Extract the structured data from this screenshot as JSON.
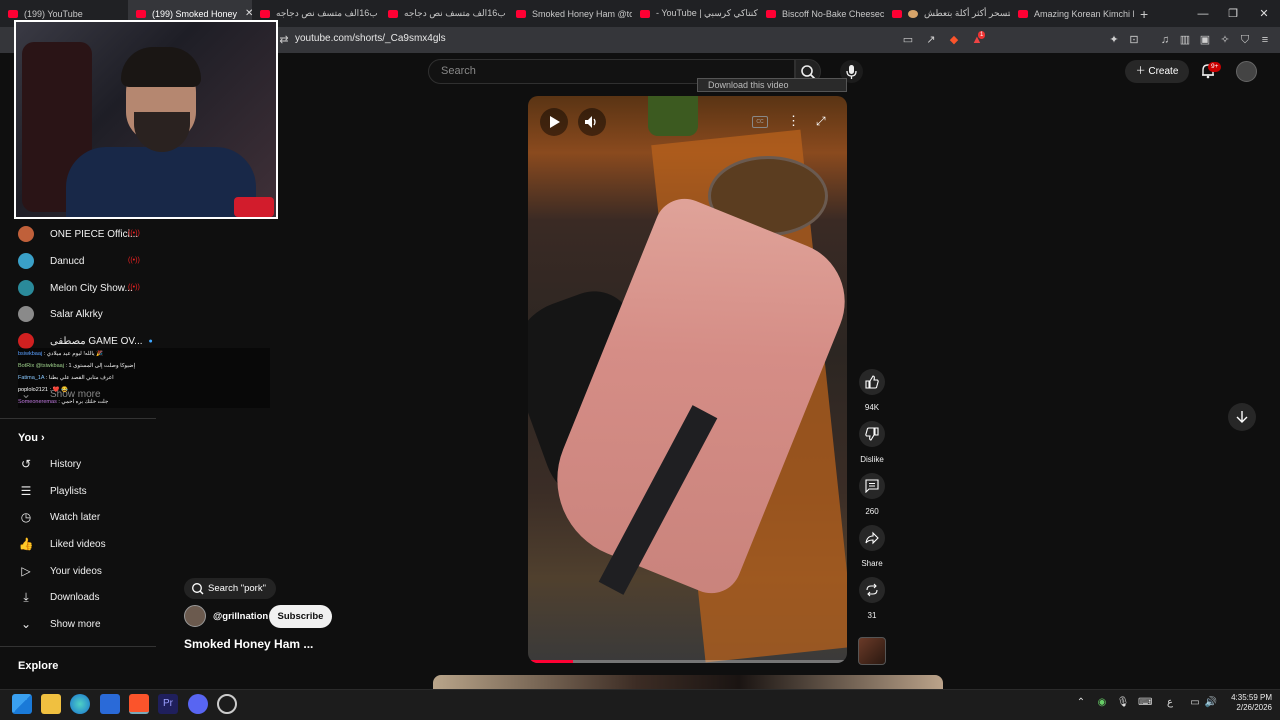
{
  "browser": {
    "tabs": [
      {
        "label": "(199) YouTube",
        "icon": "youtube-icon"
      },
      {
        "label": "(199) Smoked Honey",
        "icon": "youtube-icon",
        "active": true
      },
      {
        "label": "ب16الف متسف نص دجاجه",
        "icon": "youtube-icon"
      },
      {
        "label": "ب16الف متسف نص دجاجه",
        "icon": "youtube-icon"
      },
      {
        "label": "Smoked Honey Ham @tor",
        "icon": "youtube-icon"
      },
      {
        "label": "- YouTube | كنتاكي كرسبي",
        "icon": "youtube-icon"
      },
      {
        "label": "Biscoff No-Bake Cheeseca",
        "icon": "youtube-icon"
      },
      {
        "label": "هتسحر أكثر أكلة بتعطش",
        "icon": "youtube-icon"
      },
      {
        "label": "Amazing Korean Kimchi Fr",
        "icon": "youtube-icon"
      }
    ],
    "url": "youtube.com/shorts/_Ca9smx4gls",
    "shields_badge": "1"
  },
  "header": {
    "search_placeholder": "Search",
    "create_label": "Create",
    "notifications_badge": "9+",
    "download_banner": "Download this video"
  },
  "sidebar": {
    "subscriptions": [
      {
        "label": "ONE PIECE Offici...",
        "live": true,
        "avatar_color": "#c0603a"
      },
      {
        "label": "Danucd",
        "live": true,
        "avatar_color": "#3aa0c8"
      },
      {
        "label": "Melon City Show...",
        "live": true,
        "avatar_color": "#2a8a9a"
      },
      {
        "label": "Salar Alkrky",
        "live": false,
        "avatar_color": "#8a8a8a"
      },
      {
        "label": "مصطفى GAME OV...",
        "live": false,
        "dot": true,
        "avatar_color": "#d02020"
      }
    ],
    "show_more_subs": "Show more",
    "you_header": "You",
    "you_items": [
      {
        "label": "History",
        "icon": "history-icon"
      },
      {
        "label": "Playlists",
        "icon": "playlists-icon"
      },
      {
        "label": "Watch later",
        "icon": "clock-icon"
      },
      {
        "label": "Liked videos",
        "icon": "thumbs-up-icon"
      },
      {
        "label": "Your videos",
        "icon": "video-icon"
      },
      {
        "label": "Downloads",
        "icon": "download-icon"
      },
      {
        "label": "Show more",
        "icon": "chevron-down-icon"
      }
    ],
    "explore_header": "Explore"
  },
  "chat": [
    {
      "user": "bsiwkbaaj",
      "msg": "يالله! ليوم عيد ميلادي 🎉"
    },
    {
      "user": "BotRix @tsiwkbaaj",
      "msg": "إضيوكا وصلت إلى المستوى 1"
    },
    {
      "user": "Fatima_1A",
      "msg": "اعرف متابي القصد علي بطنا"
    },
    {
      "user": "poplolo2121",
      "msg": "❤️ 😂"
    },
    {
      "user": "Someoneremas",
      "msg": "جلت خلتك بره احمي"
    }
  ],
  "short": {
    "search_chip": "Search \"pork\"",
    "channel": "@grillnation",
    "subscribe_label": "Subscribe",
    "title": "Smoked Honey Ham ...",
    "progress": 0.14
  },
  "actions": {
    "likes": "94K",
    "dislike_label": "Dislike",
    "comments": "260",
    "share_label": "Share",
    "remix": "31"
  },
  "taskbar": {
    "time": "4:35:59 PM",
    "date": "2/26/2026",
    "lang": "ع"
  }
}
